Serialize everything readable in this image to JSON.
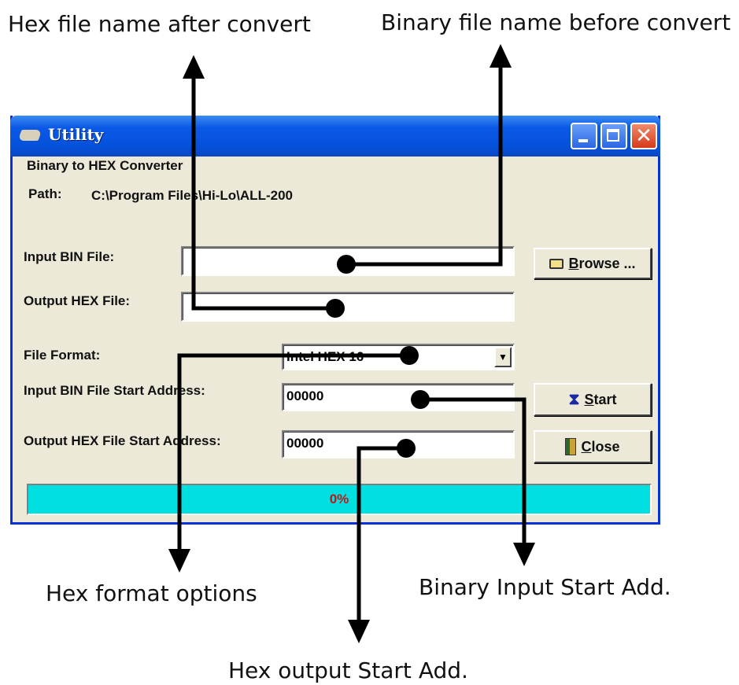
{
  "annotations": {
    "hex_file_name": "Hex file name after convert",
    "binary_file_name": "Binary file name before convert",
    "hex_format_options": "Hex format options",
    "binary_input_start": "Binary Input Start Add.",
    "hex_output_start": "Hex output Start Add."
  },
  "window": {
    "title": "Utility",
    "group_title": "Binary to HEX Converter",
    "path_label": "Path:",
    "path_value": "C:\\Program Files\\Hi-Lo\\ALL-200"
  },
  "form": {
    "input_bin_label": "Input BIN File:",
    "input_bin_value": "",
    "output_hex_label": "Output HEX File:",
    "output_hex_value": "",
    "file_format_label": "File Format:",
    "file_format_value": "Intel HEX 16",
    "input_start_label": "Input BIN File Start Address:",
    "input_start_value": "00000",
    "output_start_label": "Output HEX File Start Address:",
    "output_start_value": "00000"
  },
  "buttons": {
    "browse_key": "B",
    "browse_rest": "rowse ...",
    "start_key": "S",
    "start_rest": "tart",
    "close_key": "C",
    "close_rest": "lose"
  },
  "progress": {
    "value": 0,
    "label": "0%"
  },
  "colors": {
    "titlebar": "#0553dc",
    "progress_fill": "#00e0e0",
    "progress_text": "#d01010",
    "window_bg": "#ece9d8"
  }
}
